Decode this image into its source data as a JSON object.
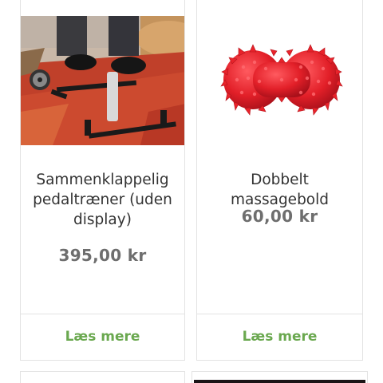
{
  "products": [
    {
      "title": "Sammenklappelig pedaltræner (uden display)",
      "price": "395,00 kr",
      "button_label": "Læs mere",
      "image_icon": "pedal-exerciser-image"
    },
    {
      "title": "Dobbelt massagebold",
      "price": "60,00 kr",
      "button_label": "Læs mere",
      "image_icon": "massage-ball-image"
    }
  ],
  "colors": {
    "accent_green": "#6aa84f",
    "price_gray": "#6e6e6e",
    "title_dark": "#333333",
    "border": "#e3e3e3",
    "ball_red": "#e8232b"
  }
}
